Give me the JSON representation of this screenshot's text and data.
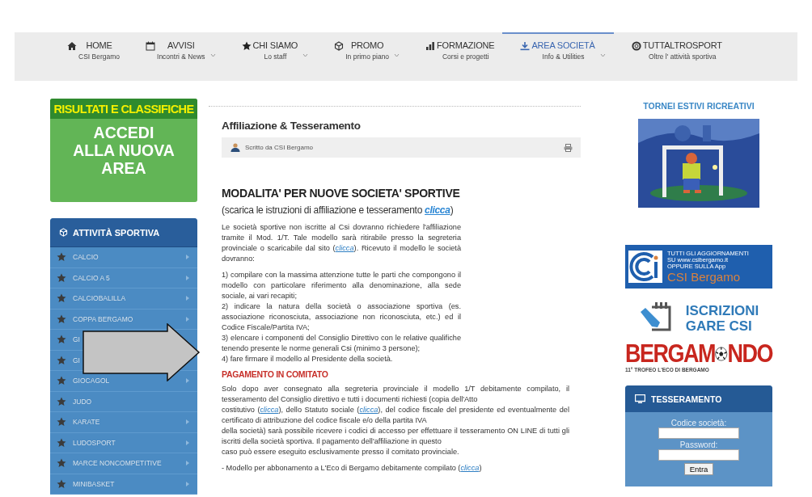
{
  "nav": {
    "items": [
      {
        "label": "HOME",
        "sub": "CSI Bergamo",
        "selected": false,
        "dropdown": false
      },
      {
        "label": "AVVISI",
        "sub": "Incontri & News",
        "selected": false,
        "dropdown": true
      },
      {
        "label": "CHI SIAMO",
        "sub": "Lo staff",
        "selected": false,
        "dropdown": true
      },
      {
        "label": "PROMO",
        "sub": "In primo piano",
        "selected": false,
        "dropdown": true
      },
      {
        "label": "FORMAZIONE",
        "sub": "Corsi e progetti",
        "selected": false,
        "dropdown": false
      },
      {
        "label": "AREA SOCIETÀ",
        "sub": "Info & Utilities",
        "selected": true,
        "dropdown": true
      },
      {
        "label": "TUTTALTROSPORT",
        "sub": "Oltre l' attività sportiva",
        "selected": false,
        "dropdown": false
      }
    ]
  },
  "left": {
    "promo": {
      "title": "RISULTATI E CLASSIFICHE",
      "lines": [
        "ACCEDI",
        "ALLA NUOVA",
        "AREA"
      ]
    },
    "menu": {
      "title": "ATTIVITÀ SPORTIVA",
      "items": [
        {
          "label": "CALCIO",
          "submenu": true
        },
        {
          "label": "CALCIO A 5",
          "submenu": true
        },
        {
          "label": "CALCIOBALILLA",
          "submenu": true
        },
        {
          "label": "COPPA BERGAMO",
          "submenu": true
        },
        {
          "label": "GI",
          "submenu": false
        },
        {
          "label": "GI",
          "submenu": false
        },
        {
          "label": "GIOCAGOL",
          "submenu": true
        },
        {
          "label": "JUDO",
          "submenu": false
        },
        {
          "label": "KARATE",
          "submenu": true
        },
        {
          "label": "LUDOSPORT",
          "submenu": true
        },
        {
          "label": "MARCE NONCOMPETITIVE",
          "submenu": true
        },
        {
          "label": "MINIBASKET",
          "submenu": true
        }
      ]
    }
  },
  "article": {
    "title": "Affiliazione & Tesseramento",
    "author": "Scritto da CSI Bergamo",
    "heading": "MODALITA' PER NUOVE SOCIETA' SPORTIVE",
    "subheading": [
      {
        "kind": "text",
        "text": "(scarica le istruzioni di affiliazione e tesseramento "
      },
      {
        "kind": "link",
        "text": "clicca"
      },
      {
        "kind": "text",
        "text": ")"
      }
    ],
    "intro": [
      [
        {
          "kind": "text",
          "text": "Le società sportive non iscritte al Csi dovranno richiedere l'affiliazione tramite il Mod. 1/T. Tale modello sarà ritirabile presso la segreteria provinciale o scaricabile dal sito ("
        },
        {
          "kind": "link",
          "text": "clicca"
        },
        {
          "kind": "text",
          "text": "). Ricevuto il modello le società dovranno:"
        }
      ],
      [
        {
          "kind": "text",
          "text": "1) compilare con la massima attenzione tutte le parti che compongono il modello con particolare riferimento alla denominazione, alla sede sociale, ai vari recapiti;"
        }
      ],
      [
        {
          "kind": "text",
          "text": "2) indicare la natura della società o associazione sportiva (es. associazione riconosciuta, associazione non riconosciuta, etc.) ed il Codice Fiscale/Partita IVA;"
        }
      ],
      [
        {
          "kind": "text",
          "text": "3) elencare i componenti del Consiglio Direttivo con le relative qualifiche tenendo presente le norme generali Csi (minimo 3 persone);"
        }
      ],
      [
        {
          "kind": "text",
          "text": "4) fare firmare il modello al Presidente della società."
        }
      ]
    ],
    "section": "PAGAMENTO IN COMITATO",
    "payment": [
      [
        {
          "kind": "text",
          "text": "Solo dopo aver consegnato alla segreteria provinciale il modello 1/T debitamente compilato, il tesseramento del Consiglio direttivo e tutti i documenti richiesti (copia dell'Atto"
        },
        {
          "kind": "break"
        },
        {
          "kind": "text",
          "text": "costitutivo ("
        },
        {
          "kind": "link",
          "text": "clicca"
        },
        {
          "kind": "text",
          "text": "), dello Statuto sociale ("
        },
        {
          "kind": "link",
          "text": "clicca"
        },
        {
          "kind": "text",
          "text": "), del codice fiscale del presidente ed eventualmente del certificato di attribuzione del codice fiscale e/o della partita IVA"
        },
        {
          "kind": "break"
        },
        {
          "kind": "text",
          "text": "della società) sarà possibile ricevere i codici di accesso per effettuare il tesseramento ON LINE di tutti gli iscritti della società sportiva. Il pagamento dell'affiliazione in questo"
        },
        {
          "kind": "break"
        },
        {
          "kind": "text",
          "text": "caso può essere eseguito esclusivamente presso il comitato provinciale."
        }
      ],
      [
        {
          "kind": "text",
          "text": "- Modello per abbonamento a L'Eco di Bergamo debitamente compilato ("
        },
        {
          "kind": "link",
          "text": "clicca"
        },
        {
          "kind": "text",
          "text": ")"
        }
      ]
    ]
  },
  "right": {
    "title": "TORNEI ESTIVI RICREATIVI",
    "app_banner": {
      "lines": [
        "TUTTI GLI AGGIORNAMENTI",
        "SU www.csibergamo.it",
        "OPPURE SULLA App"
      ],
      "brand": "CSI Bergamo"
    },
    "entries_banner": {
      "lines": [
        "ISCRIZIONI",
        "GARE CSI"
      ]
    },
    "trophy_banner": {
      "title_start": "BERGAM",
      "title_end": "NDO",
      "subtitle": "11° TROFEO L'ECO DI BERGAMO"
    },
    "login": {
      "title": "TESSERAMENTO",
      "fields": [
        {
          "label": "Codice società:"
        },
        {
          "label": "Password:"
        }
      ],
      "button": "Entra"
    }
  }
}
